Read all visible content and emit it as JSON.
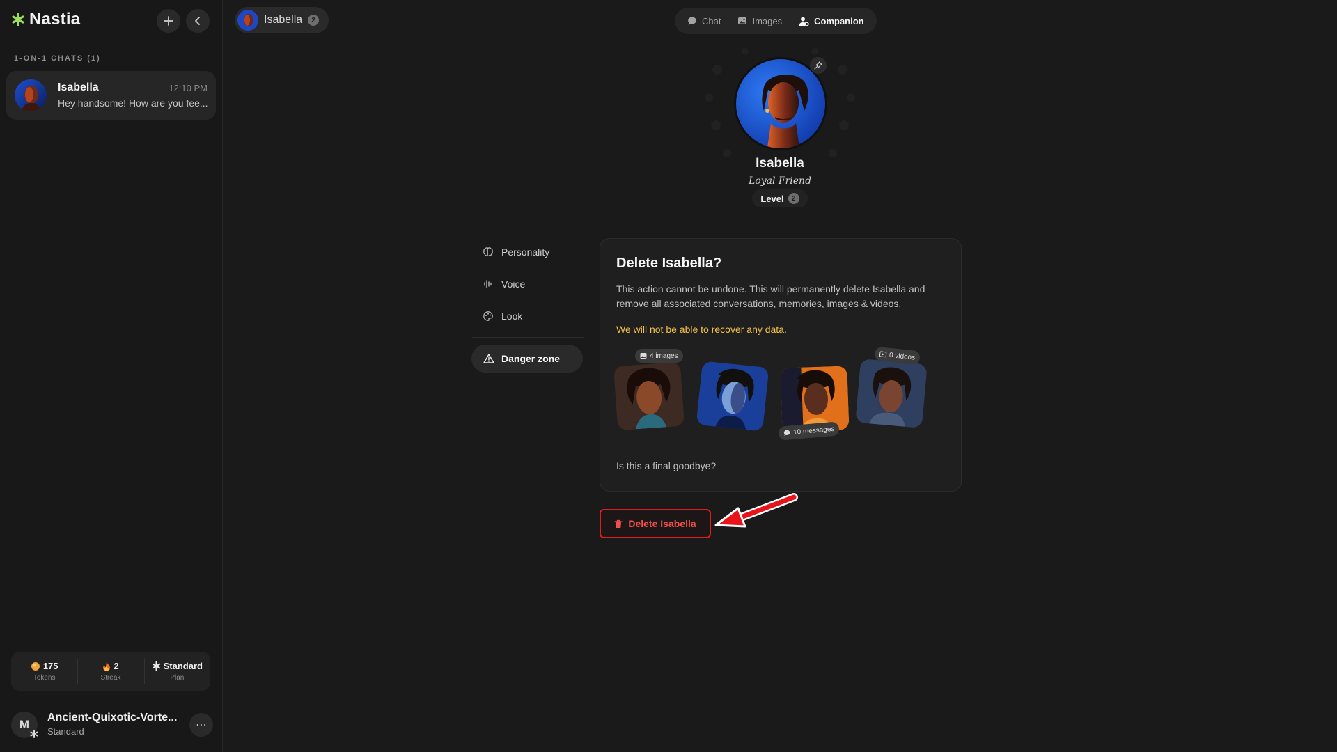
{
  "app": {
    "name": "Nastia",
    "brand_color": "#9be15d"
  },
  "sidebar": {
    "section_label": "1-ON-1 CHATS (1)",
    "chats": [
      {
        "name": "Isabella",
        "time": "12:10 PM",
        "preview": "Hey handsome! How are you fee..."
      }
    ],
    "stats": [
      {
        "value": "175",
        "label": "Tokens",
        "icon": "coin-icon"
      },
      {
        "value": "2",
        "label": "Streak",
        "icon": "flame-icon"
      },
      {
        "value": "Standard",
        "label": "Plan",
        "icon": "asterisk-icon"
      }
    ],
    "user": {
      "initial": "M",
      "name": "Ancient-Quixotic-Vorte...",
      "plan": "Standard"
    }
  },
  "header": {
    "companion_name": "Isabella",
    "companion_level": "2",
    "tabs": [
      {
        "label": "Chat",
        "icon": "chat-bubble-icon",
        "active": false
      },
      {
        "label": "Images",
        "icon": "image-icon",
        "active": false
      },
      {
        "label": "Companion",
        "icon": "user-settings-icon",
        "active": true
      }
    ]
  },
  "profile": {
    "name": "Isabella",
    "role": "Loyal Friend",
    "level_label": "Level",
    "level": "2"
  },
  "settings_nav": {
    "items": [
      {
        "label": "Personality",
        "icon": "brain-icon"
      },
      {
        "label": "Voice",
        "icon": "waveform-icon"
      },
      {
        "label": "Look",
        "icon": "palette-icon"
      }
    ],
    "danger": {
      "label": "Danger zone",
      "icon": "warning-triangle-icon"
    }
  },
  "danger_card": {
    "title": "Delete Isabella?",
    "description": "This action cannot be undone. This will permanently delete Isabella and remove all associated conversations, memories, images & videos.",
    "warning": "We will not be able to recover any data.",
    "warning_color": "#f3c24d",
    "tags": {
      "images": "4 images",
      "videos": "0 videos",
      "messages": "10 messages"
    },
    "question": "Is this a final goodbye?"
  },
  "delete_button": {
    "label": "Delete Isabella",
    "color": "#e11c1c"
  }
}
